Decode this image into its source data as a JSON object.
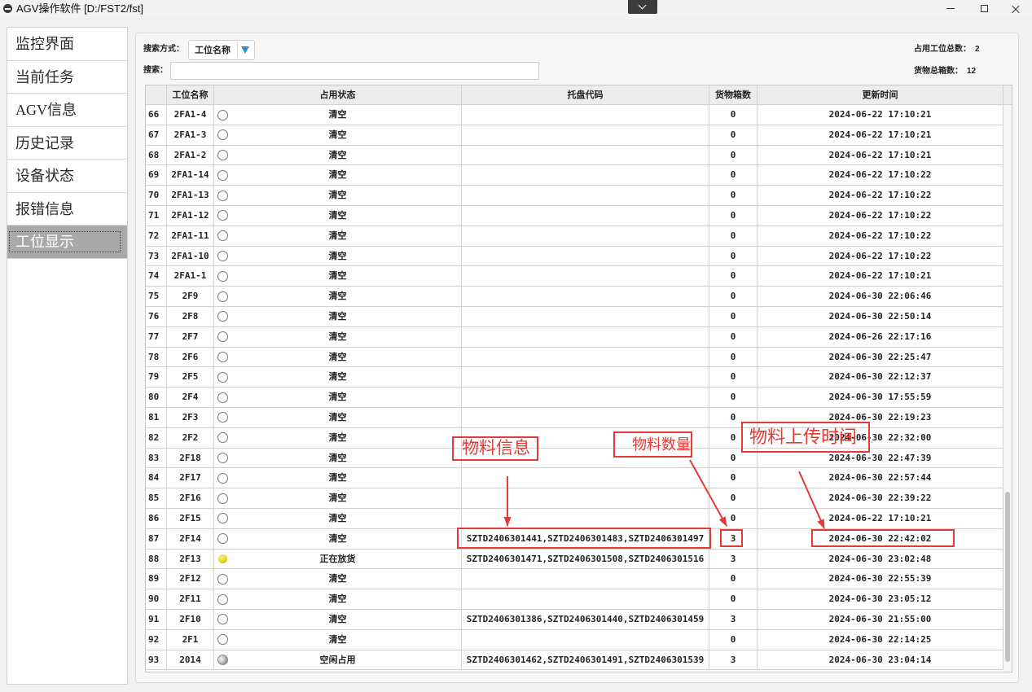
{
  "window": {
    "title": "AGV操作软件 [D:/FST2/fst]",
    "app_icon": "app-icon",
    "center_button_icon": "chevron-down-icon",
    "controls": [
      "minimize-icon",
      "maximize-icon",
      "close-icon"
    ]
  },
  "sidebar": {
    "items": [
      {
        "label": "监控界面"
      },
      {
        "label": "当前任务"
      },
      {
        "label": "AGV信息"
      },
      {
        "label": "历史记录"
      },
      {
        "label": "设备状态"
      },
      {
        "label": "报错信息"
      },
      {
        "label": "工位显示",
        "active": true
      }
    ]
  },
  "search": {
    "mode_label": "搜索方式：",
    "mode_value": "工位名称",
    "mode_arrow_icon": "triangle-down-icon",
    "search_label": "搜索："
  },
  "stats": {
    "occupied_label": "占用工位总数：",
    "occupied_value": "2",
    "boxes_label": "货物总箱数：",
    "boxes_value": "12"
  },
  "table": {
    "columns": {
      "station_name": "工位名称",
      "status": "占用状态",
      "pallet_code": "托盘代码",
      "box_count": "货物箱数",
      "update_time": "更新时间"
    },
    "rows": [
      {
        "no": "66",
        "name": "2FA1-4",
        "icon": "empty-circle-icon",
        "status": "清空",
        "pallet": "",
        "count": "0",
        "time": "2024-06-22 17:10:21"
      },
      {
        "no": "67",
        "name": "2FA1-3",
        "icon": "empty-circle-icon",
        "status": "清空",
        "pallet": "",
        "count": "0",
        "time": "2024-06-22 17:10:21"
      },
      {
        "no": "68",
        "name": "2FA1-2",
        "icon": "empty-circle-icon",
        "status": "清空",
        "pallet": "",
        "count": "0",
        "time": "2024-06-22 17:10:21"
      },
      {
        "no": "69",
        "name": "2FA1-14",
        "icon": "empty-circle-icon",
        "status": "清空",
        "pallet": "",
        "count": "0",
        "time": "2024-06-22 17:10:22"
      },
      {
        "no": "70",
        "name": "2FA1-13",
        "icon": "empty-circle-icon",
        "status": "清空",
        "pallet": "",
        "count": "0",
        "time": "2024-06-22 17:10:22"
      },
      {
        "no": "71",
        "name": "2FA1-12",
        "icon": "empty-circle-icon",
        "status": "清空",
        "pallet": "",
        "count": "0",
        "time": "2024-06-22 17:10:22"
      },
      {
        "no": "72",
        "name": "2FA1-11",
        "icon": "empty-circle-icon",
        "status": "清空",
        "pallet": "",
        "count": "0",
        "time": "2024-06-22 17:10:22"
      },
      {
        "no": "73",
        "name": "2FA1-10",
        "icon": "empty-circle-icon",
        "status": "清空",
        "pallet": "",
        "count": "0",
        "time": "2024-06-22 17:10:22"
      },
      {
        "no": "74",
        "name": "2FA1-1",
        "icon": "empty-circle-icon",
        "status": "清空",
        "pallet": "",
        "count": "0",
        "time": "2024-06-22 17:10:21"
      },
      {
        "no": "75",
        "name": "2F9",
        "icon": "empty-circle-icon",
        "status": "清空",
        "pallet": "",
        "count": "0",
        "time": "2024-06-30 22:06:46"
      },
      {
        "no": "76",
        "name": "2F8",
        "icon": "empty-circle-icon",
        "status": "清空",
        "pallet": "",
        "count": "0",
        "time": "2024-06-30 22:50:14"
      },
      {
        "no": "77",
        "name": "2F7",
        "icon": "empty-circle-icon",
        "status": "清空",
        "pallet": "",
        "count": "0",
        "time": "2024-06-26 22:17:16"
      },
      {
        "no": "78",
        "name": "2F6",
        "icon": "empty-circle-icon",
        "status": "清空",
        "pallet": "",
        "count": "0",
        "time": "2024-06-30 22:25:47"
      },
      {
        "no": "79",
        "name": "2F5",
        "icon": "empty-circle-icon",
        "status": "清空",
        "pallet": "",
        "count": "0",
        "time": "2024-06-30 22:12:37"
      },
      {
        "no": "80",
        "name": "2F4",
        "icon": "empty-circle-icon",
        "status": "清空",
        "pallet": "",
        "count": "0",
        "time": "2024-06-30 17:55:59"
      },
      {
        "no": "81",
        "name": "2F3",
        "icon": "empty-circle-icon",
        "status": "清空",
        "pallet": "",
        "count": "0",
        "time": "2024-06-30 22:19:23"
      },
      {
        "no": "82",
        "name": "2F2",
        "icon": "empty-circle-icon",
        "status": "清空",
        "pallet": "",
        "count": "0",
        "time": "2024-06-30 22:32:00"
      },
      {
        "no": "83",
        "name": "2F18",
        "icon": "empty-circle-icon",
        "status": "清空",
        "pallet": "",
        "count": "0",
        "time": "2024-06-30 22:47:39"
      },
      {
        "no": "84",
        "name": "2F17",
        "icon": "empty-circle-icon",
        "status": "清空",
        "pallet": "",
        "count": "0",
        "time": "2024-06-30 22:57:44"
      },
      {
        "no": "85",
        "name": "2F16",
        "icon": "empty-circle-icon",
        "status": "清空",
        "pallet": "",
        "count": "0",
        "time": "2024-06-30 22:39:22"
      },
      {
        "no": "86",
        "name": "2F15",
        "icon": "empty-circle-icon",
        "status": "清空",
        "pallet": "",
        "count": "0",
        "time": "2024-06-22 17:10:21"
      },
      {
        "no": "87",
        "name": "2F14",
        "icon": "empty-circle-icon",
        "status": "清空",
        "pallet": "SZTD2406301441,SZTD2406301483,SZTD2406301497",
        "count": "3",
        "time": "2024-06-30 22:42:02"
      },
      {
        "no": "88",
        "name": "2F13",
        "icon": "yellow-circle-icon",
        "status": "正在放货",
        "pallet": "SZTD2406301471,SZTD2406301508,SZTD2406301516",
        "count": "3",
        "time": "2024-06-30 23:02:48"
      },
      {
        "no": "89",
        "name": "2F12",
        "icon": "empty-circle-icon",
        "status": "清空",
        "pallet": "",
        "count": "0",
        "time": "2024-06-30 22:55:39"
      },
      {
        "no": "90",
        "name": "2F11",
        "icon": "empty-circle-icon",
        "status": "清空",
        "pallet": "",
        "count": "0",
        "time": "2024-06-30 23:05:12"
      },
      {
        "no": "91",
        "name": "2F10",
        "icon": "empty-circle-icon",
        "status": "清空",
        "pallet": "SZTD2406301386,SZTD2406301440,SZTD2406301459",
        "count": "3",
        "time": "2024-06-30 21:55:00"
      },
      {
        "no": "92",
        "name": "2F1",
        "icon": "empty-circle-icon",
        "status": "清空",
        "pallet": "",
        "count": "0",
        "time": "2024-06-30 22:14:25"
      },
      {
        "no": "93",
        "name": "2014",
        "icon": "gray-circle-icon",
        "status": "空闲占用",
        "pallet": "SZTD2406301462,SZTD2406301491,SZTD2406301539",
        "count": "3",
        "time": "2024-06-30 23:04:14"
      }
    ],
    "scrollbar": {
      "visible_fraction": 0.3,
      "scroll_fraction": 0.975
    }
  },
  "annotations": {
    "material_info": "物料信息",
    "material_count": "物料数量",
    "upload_time": "物料上传时间"
  },
  "colors": {
    "annotation_red": "#e53935",
    "selected_menu_bg": "#a9a9a9",
    "dropdown_arrow": "#2b8fd6",
    "loading_indicator": "#e3d21b",
    "occupied_indicator": "#9e9e9e"
  }
}
